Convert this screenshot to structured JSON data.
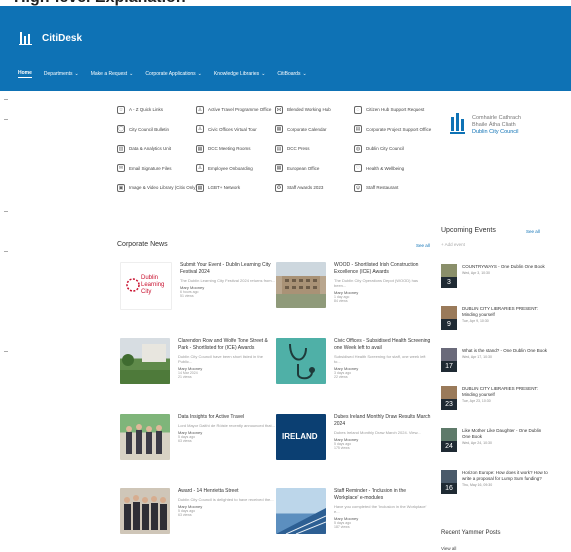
{
  "header": {
    "brand": "CitiDesk",
    "nav": [
      {
        "label": "Home",
        "active": true,
        "chevron": false
      },
      {
        "label": "Departments",
        "chevron": true
      },
      {
        "label": "Make a Request",
        "chevron": true
      },
      {
        "label": "Corporate Applications",
        "chevron": true
      },
      {
        "label": "Knowledge Libraries",
        "chevron": true
      },
      {
        "label": "CitiBoards",
        "chevron": true
      }
    ]
  },
  "quick_links": [
    {
      "label": "A - Z Quick Links",
      "icon": "star-icon"
    },
    {
      "label": "Active Travel Programme Office",
      "icon": "person-icon"
    },
    {
      "label": "Blended Working Hub",
      "icon": "network-icon"
    },
    {
      "label": "Citizen Hub Support Request",
      "icon": "speech-icon"
    },
    {
      "label": "City Council Bulletin",
      "icon": "chat-icon"
    },
    {
      "label": "Civic Offices Virtual Tour",
      "icon": "person-icon"
    },
    {
      "label": "Corporate Calendar",
      "icon": "calendar-icon"
    },
    {
      "label": "Corporate Project Support Office",
      "icon": "board-icon"
    },
    {
      "label": "Data & Analytics Unit",
      "icon": "chart-icon"
    },
    {
      "label": "DCC Meeting Rooms",
      "icon": "grid-icon"
    },
    {
      "label": "DCC Press",
      "icon": "document-icon"
    },
    {
      "label": "Dublin City Council",
      "icon": "globe-icon"
    },
    {
      "label": "Email Signature Files",
      "icon": "mail-icon"
    },
    {
      "label": "Employee Onboarding",
      "icon": "people-icon"
    },
    {
      "label": "European Office",
      "icon": "calendar-icon"
    },
    {
      "label": "Health & Wellbeing",
      "icon": "heart-icon"
    },
    {
      "label": "Image & Video Library (Citix Only)",
      "icon": "image-icon"
    },
    {
      "label": "LGBT+ Network",
      "icon": "calendar-icon"
    },
    {
      "label": "Staff Awards 2023",
      "icon": "award-icon"
    },
    {
      "label": "Staff Restaurant",
      "icon": "cutlery-icon"
    }
  ],
  "dcc_logo": {
    "line1": "Comhairle Cathrach",
    "line2": "Bhaile Átha Cliath",
    "line3": "Dublin City Council"
  },
  "news": {
    "title": "Corporate News",
    "see_all": "See all",
    "items": [
      {
        "title": "Submit Your Event - Dublin Learning City Festival 2024",
        "summary": "The Dublin Learning City Festival 2024 returns from...",
        "author": "Mary Mooney",
        "meta": "6 hours ago",
        "views": "51 views",
        "thumb": "learning",
        "thumb_text": "Dublin Learning City"
      },
      {
        "title": "WOOD - Shortlisted Irish Construction Excellence (ICE) Awards",
        "summary": "The Dublin City Operations Depot (WOOD) has been...",
        "author": "Mary Mooney",
        "meta": "1 day ago",
        "views": "84 views",
        "thumb": "building"
      },
      {
        "title": "Clarendon Row and Wolfe Tone Street & Park - Shortlisted for (ICE) Awards",
        "summary": "Dublin City Council have been short listed in the Public...",
        "author": "Mary Mooney",
        "meta": "14 Mar 2024",
        "views": "21 views",
        "thumb": "park"
      },
      {
        "title": "Civic Offices - Subsidised Health Screening one Week left to avail",
        "summary": "Subsidised Health Screening for staff, one week left to...",
        "author": "Mary Mooney",
        "meta": "3 days ago",
        "views": "22 views",
        "thumb": "stethoscope"
      },
      {
        "title": "Data Insights for Active Travel",
        "summary": "Lord Mayor Daithí de Róiste recently announced that...",
        "author": "Mary Mooney",
        "meta": "5 days ago",
        "views": "63 views",
        "thumb": "people"
      },
      {
        "title": "Dubes Ireland Monthly Draw Results March 2024",
        "summary": "Dubes Ireland Monthly Draw March 2024. View...",
        "author": "Mary Mooney",
        "meta": "5 days ago",
        "views": "175 views",
        "thumb": "ireland",
        "thumb_text": "IRELAND"
      },
      {
        "title": "Award - 14 Henrietta Street",
        "summary": "Dublin City Council is delighted to have received the...",
        "author": "Mary Mooney",
        "meta": "5 days ago",
        "views": "63 views",
        "thumb": "group"
      },
      {
        "title": "Staff Reminder - 'Inclusion in the Workplace' e-modules",
        "summary": "Have you completed the 'Inclusion in the Workplace' e...",
        "author": "Mary Mooney",
        "meta": "5 days ago",
        "views": "187 views",
        "thumb": "architecture"
      }
    ]
  },
  "events": {
    "title": "Upcoming Events",
    "see_all": "See all",
    "add": "+ Add event",
    "items": [
      {
        "day": "3",
        "title": "COUNTRYWAYS - One Dublin One Book",
        "date": "Wed, Apr 3, 10:30"
      },
      {
        "day": "9",
        "title": "DUBLIN CITY LIBRARIES PRESENT: Minding yourself",
        "date": "Tue, Apr 9, 10:30"
      },
      {
        "day": "17",
        "title": "What is the stand? - One Dublin One Book",
        "date": "Wed, Apr 17, 10:30"
      },
      {
        "day": "23",
        "title": "DUBLIN CITY LIBRARIES PRESENT: Minding yourself",
        "date": "Tue, Apr 23, 10:30"
      },
      {
        "day": "24",
        "title": "Like Mother Like Daughter - One Dublin One Book",
        "date": "Wed, Apr 24, 10:30"
      },
      {
        "day": "16",
        "title": "Horizon Europe: How does it work? How to write a proposal for Lump Sum funding?",
        "date": "Thu, May 16, 09:30"
      }
    ]
  },
  "yammer": {
    "title": "Recent Yammer Posts",
    "view_all": "View all"
  },
  "colors": {
    "brand": "#0e72b5",
    "nav_text": "#ffffff"
  }
}
